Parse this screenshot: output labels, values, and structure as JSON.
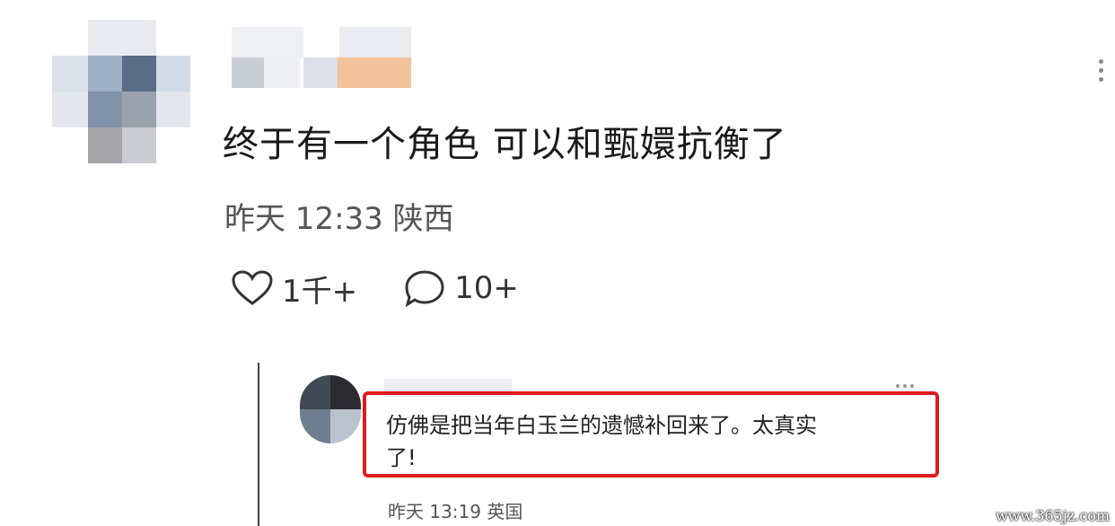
{
  "comment": {
    "text": "终于有一个角色 可以和甄嬛抗衡了",
    "time": "昨天 12:33",
    "location": "陕西",
    "likes": "1千+",
    "replies": "10+"
  },
  "reply": {
    "text_line1": "仿佛是把当年白玉兰的遗憾补回来了。太真实",
    "text_line2": "了!",
    "time": "昨天 13:19",
    "location": "英国"
  },
  "watermark": "www.365jz.com",
  "colors": {
    "highlight": "#e0191f",
    "background": "#ffffff"
  }
}
